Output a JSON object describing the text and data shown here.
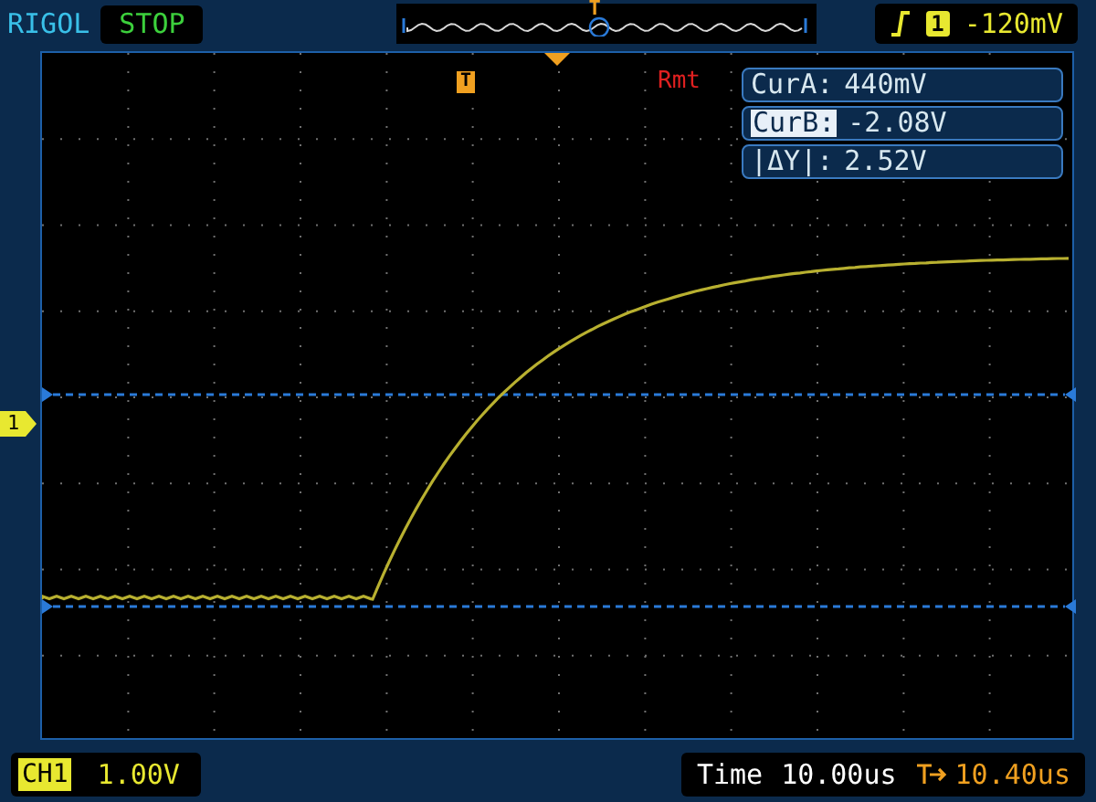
{
  "brand": "RIGOL",
  "run_state": "STOP",
  "memory_bar": {
    "marker": "T"
  },
  "trigger": {
    "channel": "1",
    "level": "-120mV"
  },
  "trigger_marker": "T",
  "cursor_mode": "Rmt",
  "cursors": [
    {
      "label": "CurA:",
      "value": "440mV",
      "selected": false
    },
    {
      "label": "CurB:",
      "value": "-2.08V",
      "selected": true
    },
    {
      "label": "|ΔY|:",
      "value": "2.52V",
      "selected": false
    }
  ],
  "channel": {
    "marker": "1",
    "name": "CH1",
    "scale": "1.00V"
  },
  "timebase": {
    "label": "Time",
    "value": "10.00us"
  },
  "trigger_offset": "10.40us"
}
